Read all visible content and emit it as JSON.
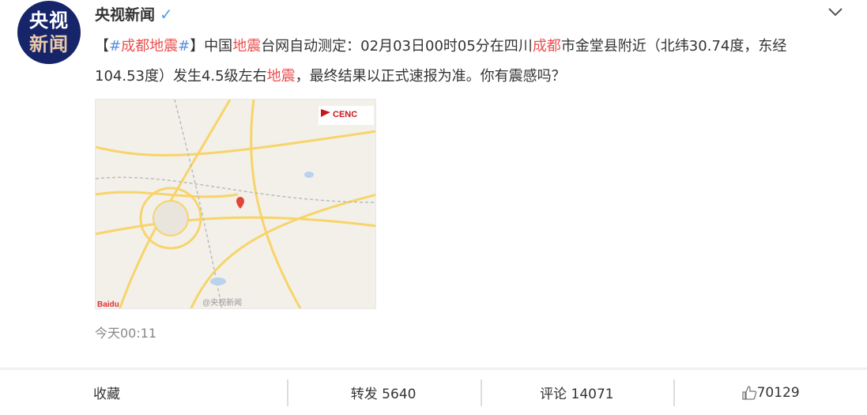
{
  "post": {
    "author": "央视新闻",
    "avatar_text": [
      "央视",
      "新闻"
    ],
    "verified_icon": "verified-v-icon",
    "menu_icon": "chevron-down-icon",
    "text_segments": [
      {
        "t": "【",
        "c": "normal"
      },
      {
        "t": "#",
        "c": "blue"
      },
      {
        "t": "成都地震",
        "c": "red"
      },
      {
        "t": "#",
        "c": "blue"
      },
      {
        "t": "】中国",
        "c": "normal"
      },
      {
        "t": "地震",
        "c": "red"
      },
      {
        "t": "台网自动测定：02月03日00时05分在四川",
        "c": "normal"
      },
      {
        "t": "成都",
        "c": "red"
      },
      {
        "t": "市金堂县附近（北纬30.74度，东经104.53度）发生4.5级左右",
        "c": "normal"
      },
      {
        "t": "地震",
        "c": "red"
      },
      {
        "t": "，最终结果以正式速报为准。你有震感吗？",
        "c": "normal"
      }
    ],
    "map_logo": "CENC",
    "map_watermark": "@央视新闻",
    "map_brand": "Baidu",
    "time": "今天00:11"
  },
  "footer": {
    "favorite": "收藏",
    "repost": "转发 5640",
    "comment": "评论 14071",
    "like": "70129",
    "like_icon": "thumbs-up-icon"
  },
  "colors": {
    "highlight": "#eb5050",
    "topic": "#5a8edb",
    "avatar_bg": "#16246a"
  }
}
